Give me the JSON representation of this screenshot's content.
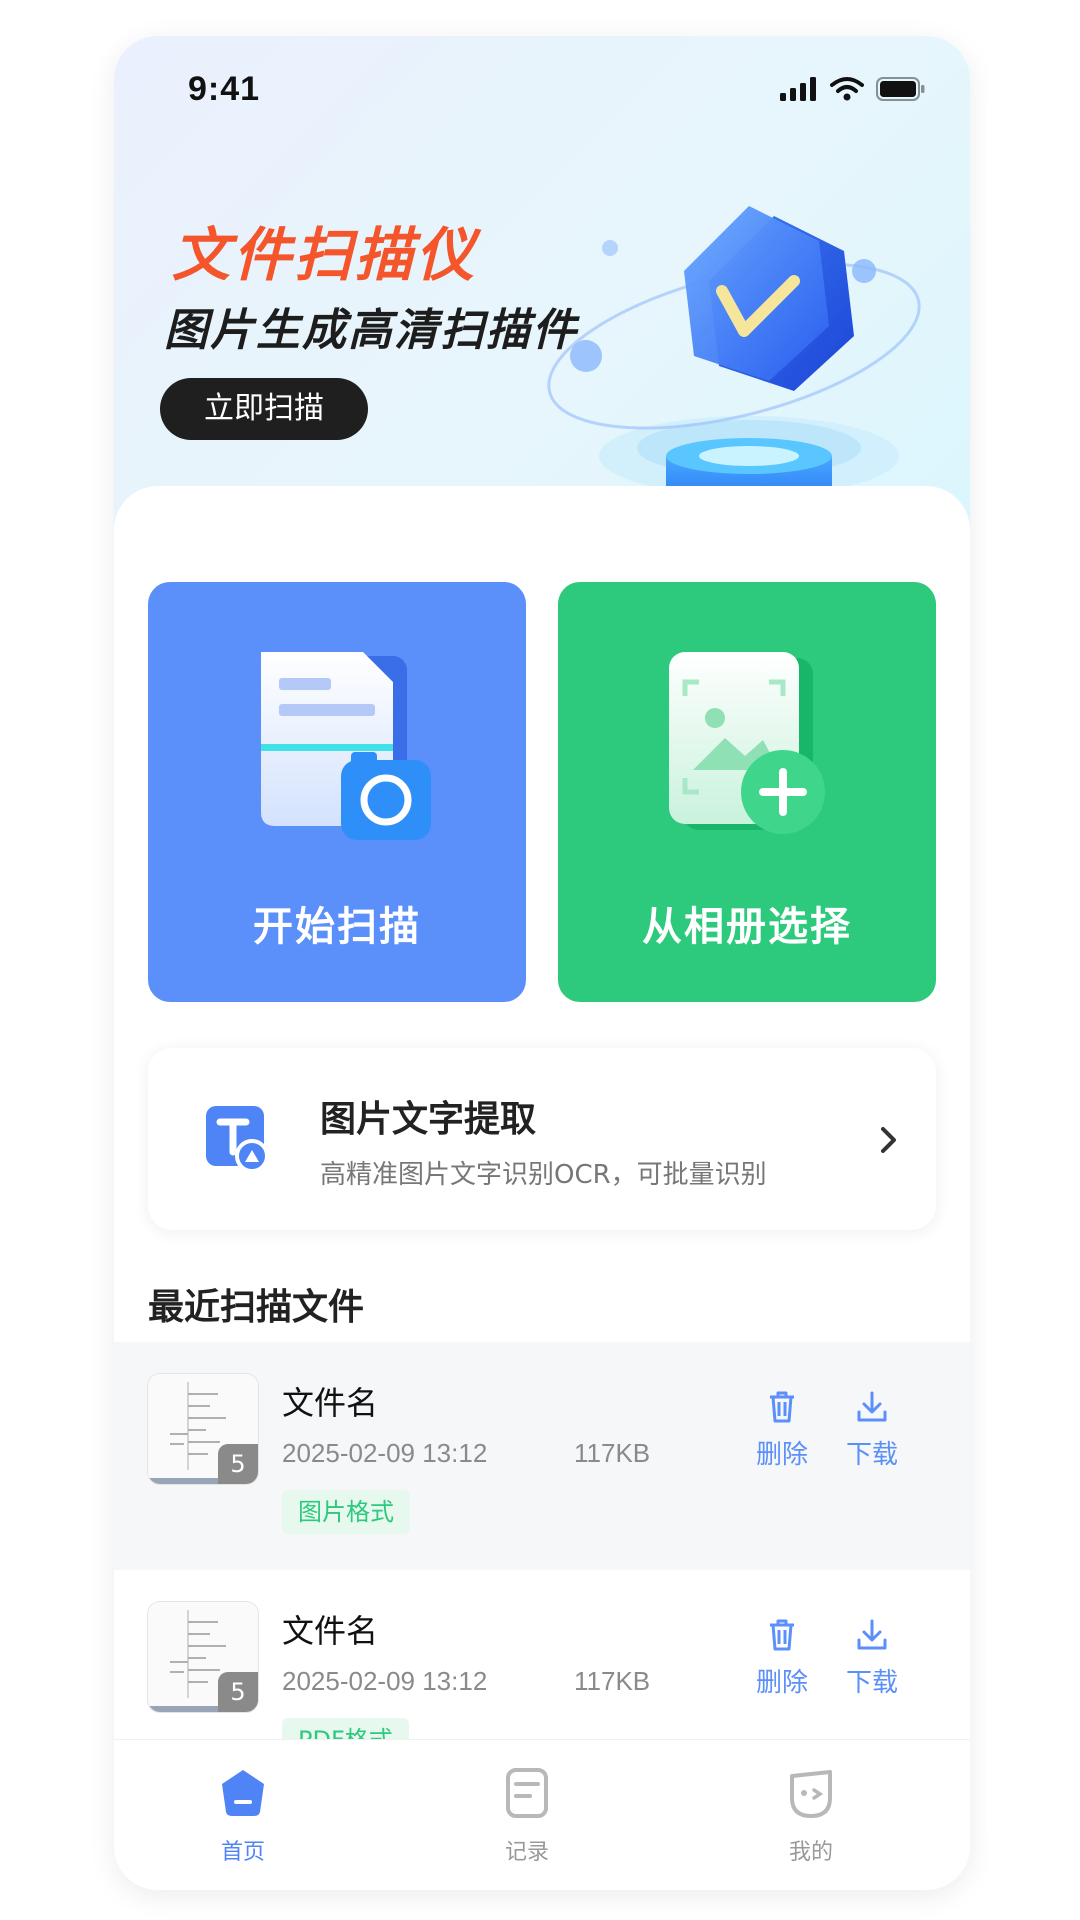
{
  "status_bar": {
    "time": "9:41"
  },
  "hero": {
    "title": "文件扫描仪",
    "subtitle": "图片生成高清扫描件",
    "button": "立即扫描"
  },
  "tiles": {
    "scan": {
      "label": "开始扫描",
      "icon": "document-camera-icon",
      "color": "#5b8ff9"
    },
    "album": {
      "label": "从相册选择",
      "icon": "image-add-icon",
      "color": "#2dc97c"
    }
  },
  "ocr": {
    "title": "图片文字提取",
    "description": "高精准图片文字识别OCR，可批量识别",
    "icon": "text-extract-icon"
  },
  "recent": {
    "title": "最近扫描文件",
    "files": [
      {
        "name": "文件名",
        "date": "2025-02-09 13:12",
        "size": "117KB",
        "tag": "图片格式",
        "count": "5"
      },
      {
        "name": "文件名",
        "date": "2025-02-09 13:12",
        "size": "117KB",
        "tag": "PDF格式",
        "count": "5"
      }
    ],
    "actions": {
      "delete": "删除",
      "download": "下载"
    }
  },
  "tabbar": {
    "items": [
      {
        "label": "首页",
        "icon": "home-icon",
        "active": true
      },
      {
        "label": "记录",
        "icon": "records-icon",
        "active": false
      },
      {
        "label": "我的",
        "icon": "profile-icon",
        "active": false
      }
    ]
  },
  "colors": {
    "accent_blue": "#5b8ff9",
    "accent_green": "#2dc97c",
    "title_orange": "#f4552a"
  }
}
